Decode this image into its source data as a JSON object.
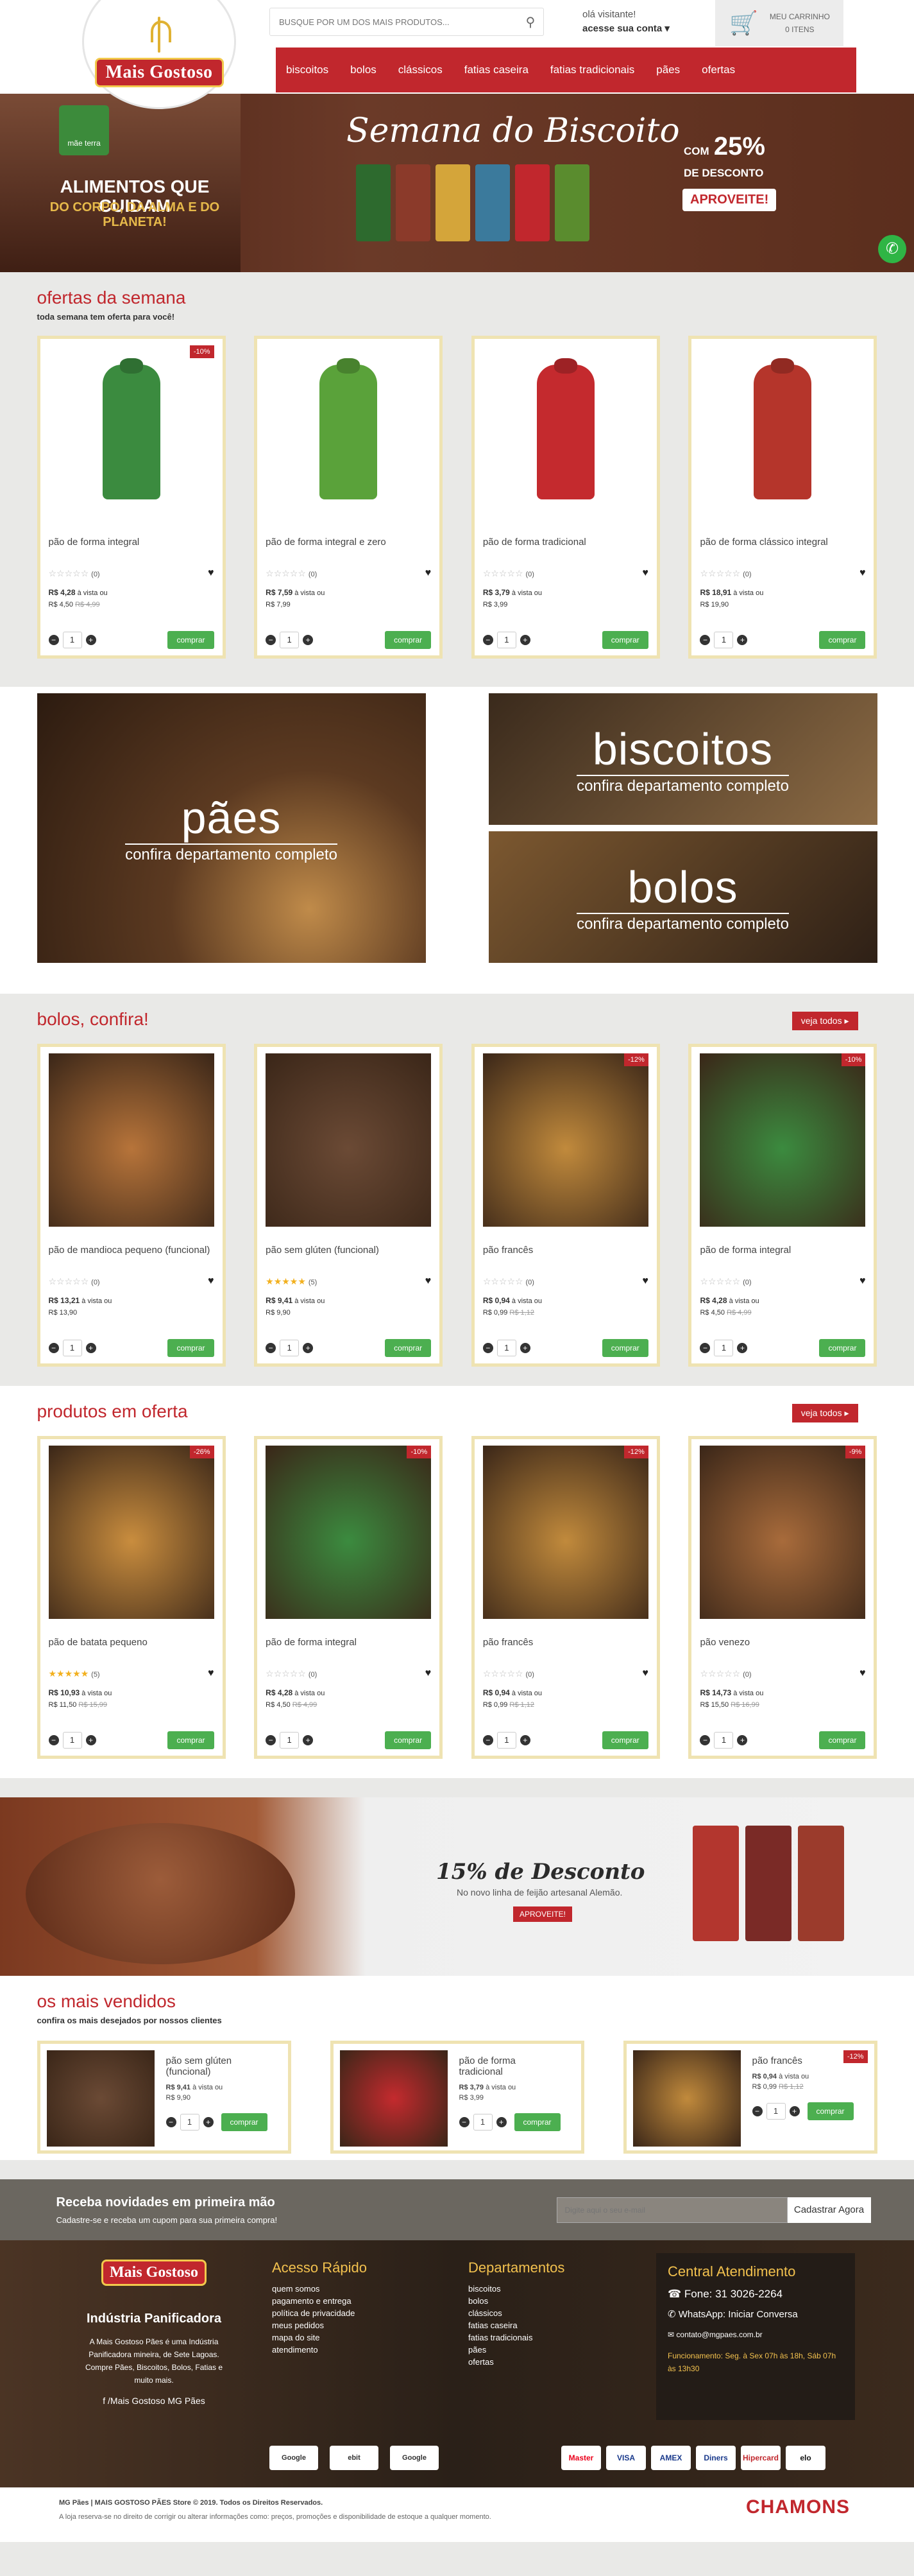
{
  "header": {
    "brand": "Mais Gostoso",
    "search_placeholder": "BUSQUE POR UM DOS MAIS PRODUTOS...",
    "user_hello": "olá visitante!",
    "user_account": "acesse sua conta ▾",
    "cart_label": "MEU CARRINHO",
    "cart_count": "0 ITENS",
    "menu": [
      "biscoitos",
      "bolos",
      "clássicos",
      "fatias caseira",
      "fatias tradicionais",
      "pães",
      "ofertas"
    ]
  },
  "hero": {
    "mae_terra": "mãe terra",
    "tagline": "ALIMENTOS QUE CUIDAM",
    "tagline2": "DO CORPO, DA ALMA E DO PLANETA!",
    "title": "Semana do Biscoito",
    "discount_prefix": "COM",
    "discount_value": "25%",
    "discount_suffix": "DE DESCONTO",
    "cta": "APROVEITE!"
  },
  "ofertas_semana": {
    "title": "ofertas da semana",
    "subtitle": "toda semana tem oferta para você!",
    "products": [
      {
        "name": "pão de forma integral",
        "badge": "-10%",
        "rating": "(0)",
        "price": "R$ 4,28",
        "price_note": "à vista ou",
        "price2": "R$ 4,50",
        "old": "R$ 4,99",
        "color": "#3b8b3f"
      },
      {
        "name": "pão de forma integral e zero",
        "badge": "",
        "rating": "(0)",
        "price": "R$ 7,59",
        "price_note": "à vista ou",
        "price2": "R$ 7,99",
        "old": "",
        "color": "#5aa23a"
      },
      {
        "name": "pão de forma tradicional",
        "badge": "",
        "rating": "(0)",
        "price": "R$ 3,79",
        "price_note": "à vista ou",
        "price2": "R$ 3,99",
        "old": "",
        "color": "#c42a2e"
      },
      {
        "name": "pão de forma clássico integral",
        "badge": "",
        "rating": "(0)",
        "price": "R$ 18,91",
        "price_note": "à vista ou",
        "price2": "R$ 19,90",
        "old": "",
        "color": "#b5352b"
      }
    ]
  },
  "departments": [
    {
      "name": "pães",
      "sub": "confira departamento completo"
    },
    {
      "name": "biscoitos",
      "sub": "confira departamento completo"
    },
    {
      "name": "bolos",
      "sub": "confira departamento completo"
    }
  ],
  "bolos": {
    "title": "bolos, confira!",
    "veja": "veja todos ▸",
    "products": [
      {
        "name": "pão de mandioca pequeno (funcional)",
        "badge": "",
        "stars": "☆☆☆☆☆",
        "rating": "(0)",
        "price": "R$ 13,21",
        "price_note": "à vista ou",
        "price2": "R$ 13,90",
        "old": "",
        "photo": "#b7743a"
      },
      {
        "name": "pão sem glúten (funcional)",
        "badge": "",
        "stars": "★★★★★",
        "rating": "(5)",
        "price": "R$ 9,41",
        "price_note": "à vista ou",
        "price2": "R$ 9,90",
        "old": "",
        "photo": "#6b4a35"
      },
      {
        "name": "pão francês",
        "badge": "-12%",
        "stars": "☆☆☆☆☆",
        "rating": "(0)",
        "price": "R$ 0,94",
        "price_note": "à vista ou",
        "price2": "R$ 0,99",
        "old": "R$ 1,12",
        "photo": "#c18a3c"
      },
      {
        "name": "pão de forma integral",
        "badge": "-10%",
        "stars": "☆☆☆☆☆",
        "rating": "(0)",
        "price": "R$ 4,28",
        "price_note": "à vista ou",
        "price2": "R$ 4,50",
        "old": "R$ 4,99",
        "photo": "#3b8b3f"
      }
    ]
  },
  "produtos_oferta": {
    "title": "produtos em oferta",
    "veja": "veja todos ▸",
    "products": [
      {
        "name": "pão de batata pequeno",
        "badge": "-26%",
        "stars": "★★★★★",
        "rating": "(5)",
        "price": "R$ 10,93",
        "price_note": "à vista ou",
        "price2": "R$ 11,50",
        "old": "R$ 15,99",
        "photo": "#c98d3e"
      },
      {
        "name": "pão de forma integral",
        "badge": "-10%",
        "stars": "☆☆☆☆☆",
        "rating": "(0)",
        "price": "R$ 4,28",
        "price_note": "à vista ou",
        "price2": "R$ 4,50",
        "old": "R$ 4,99",
        "photo": "#3b8b3f"
      },
      {
        "name": "pão francês",
        "badge": "-12%",
        "stars": "☆☆☆☆☆",
        "rating": "(0)",
        "price": "R$ 0,94",
        "price_note": "à vista ou",
        "price2": "R$ 0,99",
        "old": "R$ 1,12",
        "photo": "#c18a3c"
      },
      {
        "name": "pão venezo",
        "badge": "-9%",
        "stars": "☆☆☆☆☆",
        "rating": "(0)",
        "price": "R$ 14,73",
        "price_note": "à vista ou",
        "price2": "R$ 15,50",
        "old": "R$ 16,99",
        "photo": "#a86b3b"
      }
    ]
  },
  "promo": {
    "title": "15% de Desconto",
    "sub": "No novo linha de feijão artesanal Alemão.",
    "cta": "APROVEITE!"
  },
  "mais_vendidos": {
    "title": "os mais vendidos",
    "subtitle": "confira os mais desejados por nossos clientes",
    "products": [
      {
        "name": "pão sem glúten (funcional)",
        "badge": "",
        "price": "R$ 9,41",
        "price_note": "à vista ou",
        "price2": "R$ 9,90",
        "old": "",
        "photo": "#6b4a35"
      },
      {
        "name": "pão de forma tradicional",
        "badge": "",
        "price": "R$ 3,79",
        "price_note": "à vista ou",
        "price2": "R$ 3,99",
        "old": "",
        "photo": "#c42a2e"
      },
      {
        "name": "pão francês",
        "badge": "-12%",
        "price": "R$ 0,94",
        "price_note": "à vista ou",
        "price2": "R$ 0,99",
        "old": "R$ 1,12",
        "photo": "#c18a3c"
      }
    ]
  },
  "qty": "1",
  "buy_label": "comprar",
  "newsletter": {
    "title": "Receba novidades em primeira mão",
    "sub": "Cadastre-se e receba um cupom para sua primeira compra!",
    "placeholder": "Digite aqui o seu e-mail",
    "button": "Cadastrar Agora"
  },
  "footer": {
    "brand": "Mais Gostoso",
    "company": "Indústria Panificadora",
    "desc": "A Mais Gostoso Pães é uma Indústria Panificadora mineira, de Sete Lagoas. Compre Pães, Biscoitos, Bolos, Fatias e muito mais.",
    "facebook": "/Mais Gostoso MG Pães",
    "acesso_title": "Acesso Rápido",
    "acesso": [
      "quem somos",
      "pagamento e entrega",
      "política de privacidade",
      "meus pedidos",
      "mapa do site",
      "atendimento"
    ],
    "dept_title": "Departamentos",
    "depts": [
      "biscoitos",
      "bolos",
      "clássicos",
      "fatias caseira",
      "fatias tradicionais",
      "pães",
      "ofertas"
    ],
    "atd_title": "Central Atendimento",
    "phone": "☎ Fone: 31 3026-2264",
    "whatsapp": "WhatsApp: Iniciar Conversa",
    "email": "✉ contato@mgpaes.com.br",
    "hours": "Funcionamento: Seg. à Sex 07h às 18h, Sáb 07h às 13h30",
    "badges": [
      "Google",
      "ebit",
      "Google"
    ],
    "payments": [
      "Master",
      "VISA",
      "AMEX",
      "Diners",
      "Hipercard",
      "elo"
    ]
  },
  "bottom": {
    "copyright": "MG Pães | MAIS GOSTOSO PÃES Store © 2019. Todos os Direitos Reservados.",
    "note": "A loja reserva-se no direito de corrigir ou alterar informações como: preços, promoções e disponibilidade de estoque a qualquer momento.",
    "agency": "CHAMONS"
  }
}
